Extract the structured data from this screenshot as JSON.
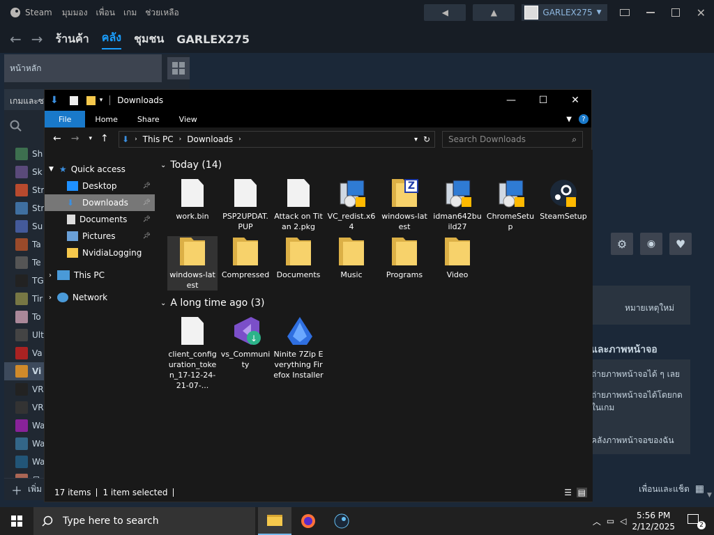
{
  "steam": {
    "app_name": "Steam",
    "menu": [
      "มุมมอง",
      "เพื่อน",
      "เกม",
      "ช่วยเหลือ"
    ],
    "username": "GARLEX275",
    "nav_tabs": [
      "ร้านค้า",
      "คลัง",
      "ชุมชน",
      "GARLEX275"
    ],
    "active_tab": "คลัง",
    "home_label": "หน้าหลัก",
    "games_label": "เกมและซ",
    "game_list": [
      "Sh",
      "Sk",
      "Str",
      "Str",
      "Su",
      "Ta",
      "Te",
      "TG",
      "Tir",
      "To",
      "Ult",
      "Va",
      "VR",
      "VR",
      "Wa",
      "Wa",
      "Wa",
      "星"
    ],
    "selected_game": "Vi",
    "game_icon_colors": [
      "#3d6f4f",
      "#5a4a7a",
      "#b84a2e",
      "#3f6fa0",
      "#445a9a",
      "#9a4a2a",
      "#555555",
      "#222222",
      "#777744",
      "#aa8899",
      "#444444",
      "#aa2222",
      "#222222",
      "#333333",
      "#882299",
      "#336688",
      "#225577",
      "#aa6655"
    ],
    "add_game_label": "เพิ่ม",
    "right_texts": {
      "unread": "หมายเหตุใหม่",
      "screenshots": "และภาพหน้าจอ",
      "s1": "ถ่ายภาพหน้าจอได้ ๆ เลย",
      "s2": "ถ่ายภาพหน้าจอได้โดยกด",
      "s3": "ในเกม",
      "s4": "คลังภาพหน้าจอของฉัน"
    },
    "friends_label": "เพื่อนและแช็ต"
  },
  "explorer": {
    "title": "Downloads",
    "ribbon_tabs": [
      "File",
      "Home",
      "Share",
      "View"
    ],
    "breadcrumb": [
      "This PC",
      "Downloads"
    ],
    "search_placeholder": "Search Downloads",
    "nav_pane": {
      "quick_access": "Quick access",
      "pinned": [
        "Desktop",
        "Downloads",
        "Documents",
        "Pictures"
      ],
      "other": [
        "NvidiaLogging"
      ],
      "this_pc": "This PC",
      "network": "Network"
    },
    "groups": [
      {
        "header": "Today (14)"
      },
      {
        "header": "A long time ago (3)"
      }
    ],
    "today_items": [
      {
        "name": "work.bin",
        "kind": "doc"
      },
      {
        "name": "PSP2UPDAT.PUP",
        "kind": "doc"
      },
      {
        "name": "Attack on Titan 2.pkg",
        "kind": "doc"
      },
      {
        "name": "VC_redist.x64",
        "kind": "installer"
      },
      {
        "name": "windows-latest",
        "kind": "zip"
      },
      {
        "name": "idman642build27",
        "kind": "installer"
      },
      {
        "name": "ChromeSetup",
        "kind": "installer"
      },
      {
        "name": "SteamSetup",
        "kind": "steam"
      },
      {
        "name": "windows-latest",
        "kind": "folder"
      },
      {
        "name": "Compressed",
        "kind": "folder"
      },
      {
        "name": "Documents",
        "kind": "folder"
      },
      {
        "name": "Music",
        "kind": "folder"
      },
      {
        "name": "Programs",
        "kind": "folder"
      },
      {
        "name": "Video",
        "kind": "folder"
      }
    ],
    "old_items": [
      {
        "name": "client_configuration_token_17-12-24-21-07-...",
        "kind": "doc"
      },
      {
        "name": "vs_Community",
        "kind": "vs"
      },
      {
        "name": "Ninite 7Zip Everything Firefox Installer",
        "kind": "ninite"
      }
    ],
    "status_items": "17 items",
    "status_selected": "1 item selected"
  },
  "taskbar": {
    "search_placeholder": "Type here to search",
    "time": "5:56 PM",
    "date": "2/12/2025",
    "notif_count": "2"
  },
  "colors": {
    "steam_bg": "#1b2838",
    "accent": "#1a9fff",
    "explorer_bg": "#191919",
    "ribbon_file": "#1979ca"
  }
}
